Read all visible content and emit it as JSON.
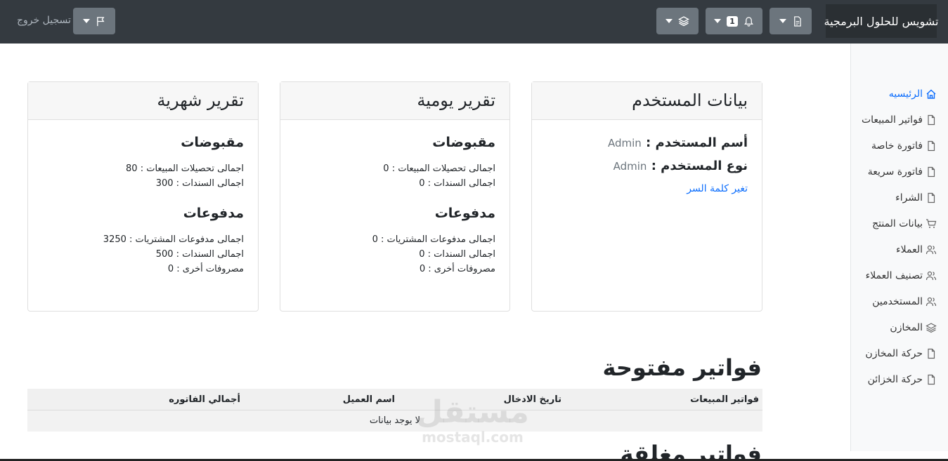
{
  "navbar": {
    "brand": "تشويس للحلول البرمجية",
    "notifications_count": "1",
    "logout": "تسجيل خروج",
    "buttons": [
      {
        "icon": "document-icon"
      },
      {
        "icon": "bell-icon"
      },
      {
        "icon": "layers-icon"
      },
      {
        "icon": "flag-icon"
      }
    ]
  },
  "sidebar": {
    "items": [
      {
        "label": "الرئيسيه",
        "icon": "home-icon",
        "active": true
      },
      {
        "label": "فواتير المبيعات",
        "icon": "document-icon"
      },
      {
        "label": "فاتورة خاصة",
        "icon": "document-icon"
      },
      {
        "label": "فاتورة سريعة",
        "icon": "document-icon"
      },
      {
        "label": "الشراء",
        "icon": "document-icon"
      },
      {
        "label": "بيانات المنتج",
        "icon": "cart-icon"
      },
      {
        "label": "العملاء",
        "icon": "users-icon"
      },
      {
        "label": "تصنيف العملاء",
        "icon": "users-icon"
      },
      {
        "label": "المستخدمين",
        "icon": "users-icon"
      },
      {
        "label": "المخازن",
        "icon": "layers-icon"
      },
      {
        "label": "حركة المخازن",
        "icon": "document-icon"
      },
      {
        "label": "حركة الخزائن",
        "icon": "document-icon"
      }
    ]
  },
  "user_card": {
    "title": "بيانات المستخدم",
    "username_label": "أسم المستخدم :",
    "username_value": "Admin",
    "usertype_label": "نوع المستخدم :",
    "usertype_value": "Admin",
    "change_password": "تغير كلمة السر"
  },
  "daily_card": {
    "title": "تقرير يومية",
    "receipts_title": "مقبوضات",
    "sales_collections": "اجمالى تحصيلات المبيعات : 0",
    "receipts_bonds": "اجمالى السندات : 0",
    "payments_title": "مدفوعات",
    "purchase_payments": "اجمالى مدفوعات المشتريات : 0",
    "payments_bonds": "اجمالى السندات : 0",
    "other_expenses": "مصروفات أخرى : 0"
  },
  "monthly_card": {
    "title": "تقرير شهرية",
    "receipts_title": "مقبوضات",
    "sales_collections": "اجمالى تحصيلات المبيعات : 80",
    "receipts_bonds": "اجمالى السندات : 300",
    "payments_title": "مدفوعات",
    "purchase_payments": "اجمالى مدفوعات المشتريات : 3250",
    "payments_bonds": "اجمالى السندات : 500",
    "other_expenses": "مصروفات أخرى : 0"
  },
  "open_invoices": {
    "title": "فواتير مفتوحة",
    "columns": [
      "فواتير المبيعات",
      "تاريخ الادخال",
      "اسم العميل",
      "أجمالي الفاتوره"
    ],
    "empty": "لا يوجد بيانات"
  },
  "closed_invoices": {
    "title": "فواتير مغلقة"
  },
  "watermark": {
    "ar": "مستقل",
    "en": "mostaql.com"
  }
}
